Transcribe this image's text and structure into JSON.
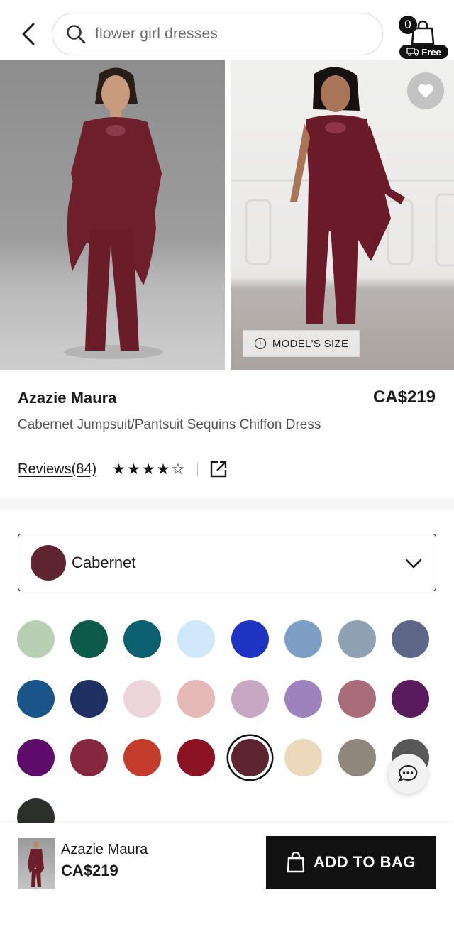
{
  "header": {
    "search_text": "flower girl dresses",
    "cart_count": "0",
    "cart_badge": "Free"
  },
  "gallery": {
    "model_size_label": "MODEL'S SIZE"
  },
  "product": {
    "brand": "Azazie Maura",
    "price": "CA$219",
    "description": "Cabernet Jumpsuit/Pantsuit Sequins Chiffon Dress",
    "reviews_label": "Reviews(84)",
    "rating": 4,
    "rating_max": 5
  },
  "color_select": {
    "selected_label": "Cabernet",
    "selected_color": "#5e2432"
  },
  "swatches": [
    {
      "color": "#b8cfb4"
    },
    {
      "color": "#0d5a4a"
    },
    {
      "color": "#0b5f6e"
    },
    {
      "color": "#cfe9fb"
    },
    {
      "color": "#1f33c2"
    },
    {
      "color": "#7d9fc6"
    },
    {
      "color": "#8ea2b3"
    },
    {
      "color": "#5e6788"
    },
    {
      "color": "#1b5489"
    },
    {
      "color": "#1f3062"
    },
    {
      "color": "#ecd5da"
    },
    {
      "color": "#e6b9b8"
    },
    {
      "color": "#c7a7c2"
    },
    {
      "color": "#9d82bd"
    },
    {
      "color": "#a86c7b"
    },
    {
      "color": "#5a1b5e"
    },
    {
      "color": "#5f0b6b"
    },
    {
      "color": "#85273f"
    },
    {
      "color": "#c33b2a"
    },
    {
      "color": "#8a1223"
    },
    {
      "color": "#5e2432",
      "selected": true
    },
    {
      "color": "#ecd8bb"
    },
    {
      "color": "#8f877c"
    },
    {
      "color": "#585858"
    },
    {
      "color": "#2c302b"
    }
  ],
  "bottom_bar": {
    "name": "Azazie Maura",
    "price": "CA$219",
    "add_button_label": "ADD TO BAG"
  }
}
